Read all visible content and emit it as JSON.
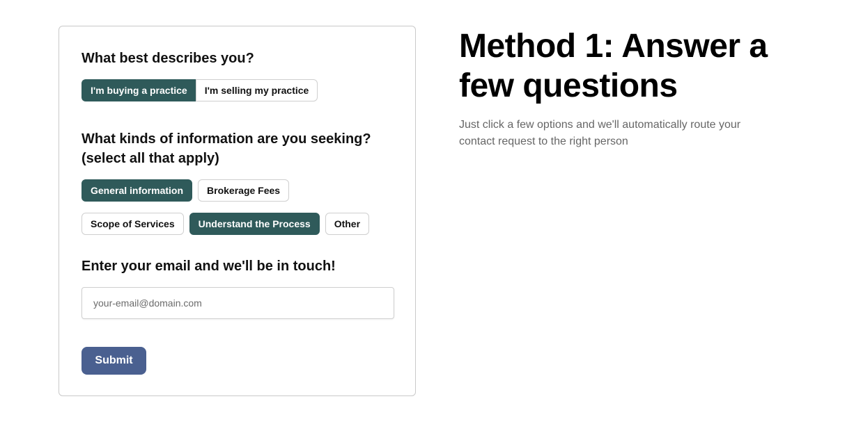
{
  "form": {
    "question_role": "What best describes you?",
    "role_options": [
      {
        "label": "I'm buying a practice",
        "selected": true
      },
      {
        "label": "I'm selling my practice",
        "selected": false
      }
    ],
    "question_info": "What kinds of information are you seeking? (select all that apply)",
    "info_options": [
      {
        "label": "General information",
        "selected": true
      },
      {
        "label": "Brokerage Fees",
        "selected": false
      },
      {
        "label": "Scope of Services",
        "selected": false
      },
      {
        "label": "Understand the Process",
        "selected": true
      },
      {
        "label": "Other",
        "selected": false
      }
    ],
    "email_heading": "Enter your email and we'll be in touch!",
    "email_value": "",
    "email_placeholder": "your-email@domain.com",
    "submit_label": "Submit"
  },
  "intro": {
    "title": "Method 1: Answer a few questions",
    "subtitle": "Just click a few options and we'll automatically route your contact request to the right person"
  },
  "colors": {
    "selected_chip": "#2f5a5a",
    "submit_button": "#4a6090",
    "card_border": "#c9c9c9"
  }
}
